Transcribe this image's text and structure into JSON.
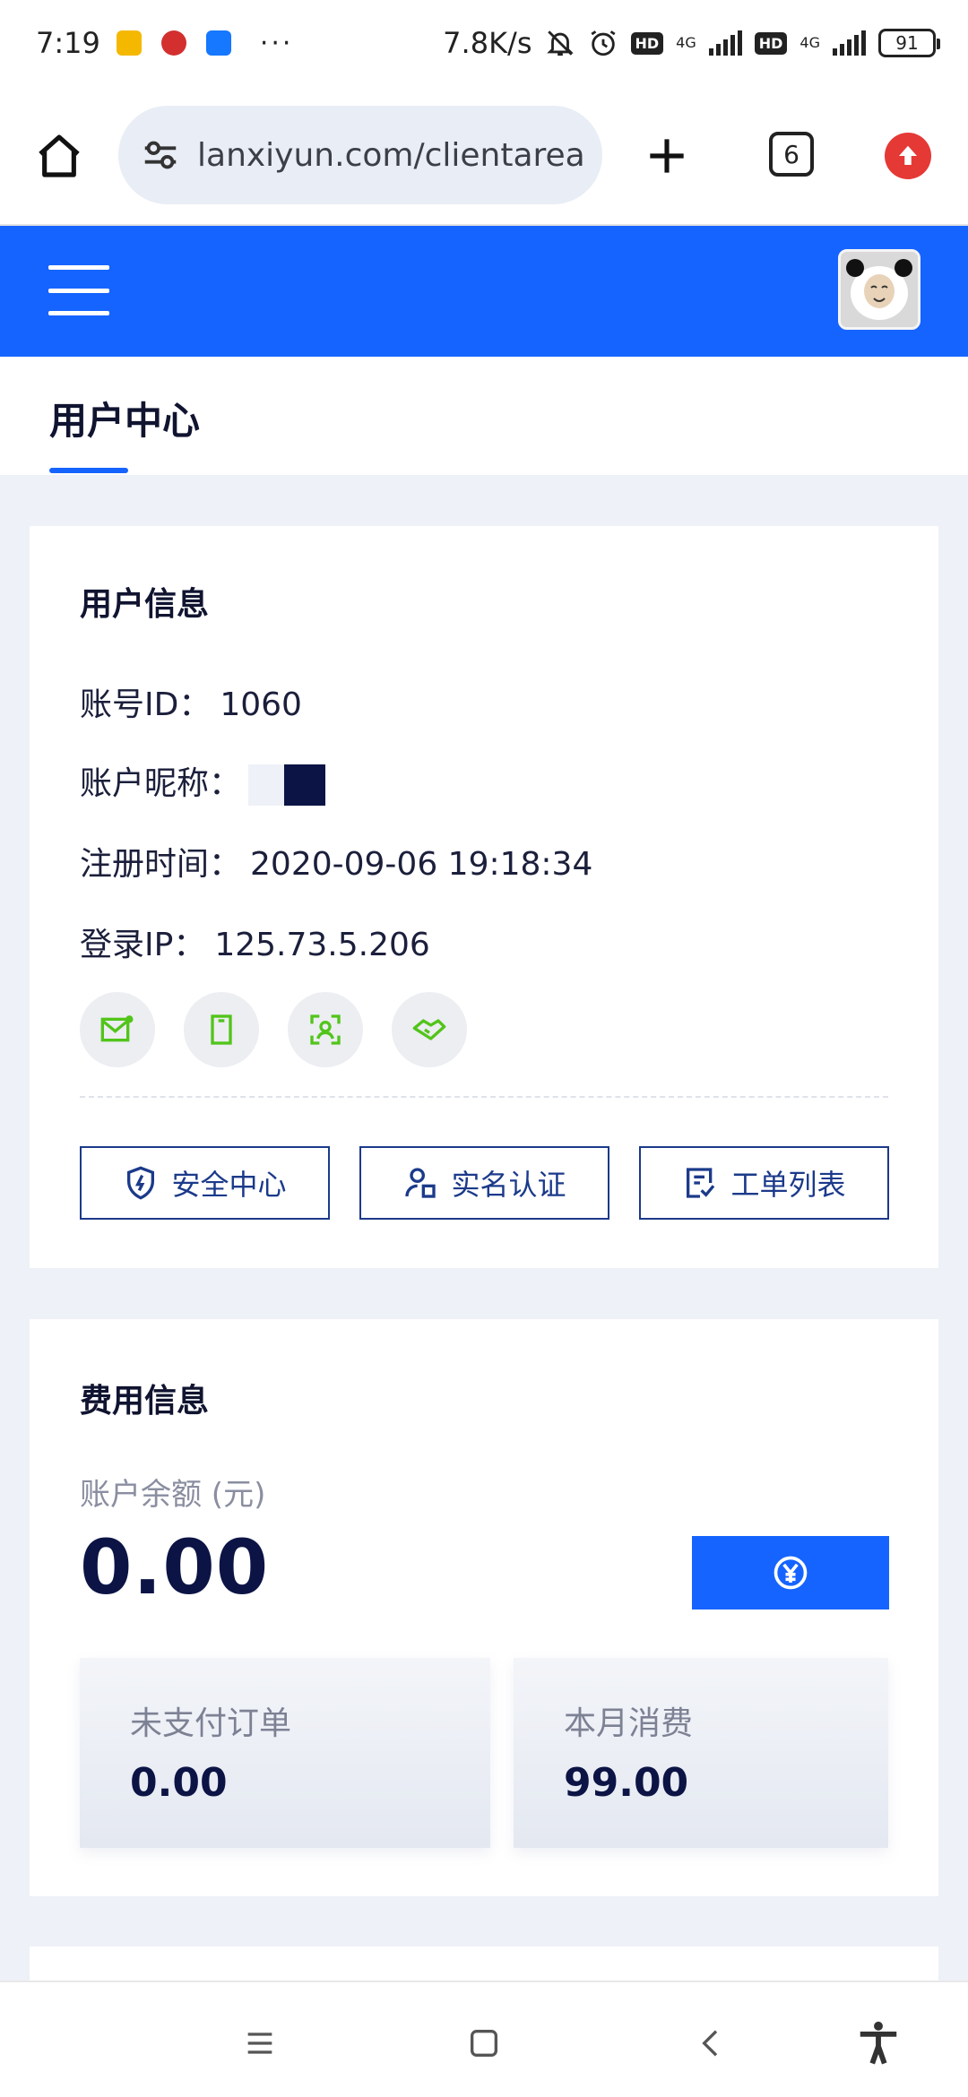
{
  "status_bar": {
    "time": "7:19",
    "more": "···",
    "net_speed": "7.8K/s",
    "net1": "4G",
    "net2": "4G",
    "hd1": "HD",
    "hd2": "HD",
    "battery": "91"
  },
  "browser": {
    "url": "lanxiyun.com/clientarea",
    "tab_count": "6"
  },
  "page": {
    "title": "用户中心"
  },
  "user_info": {
    "heading": "用户信息",
    "account_id_label": "账号ID：",
    "account_id": "1060",
    "nickname_label": "账户昵称：",
    "register_label": "注册时间：",
    "register_time": "2020-09-06 19:18:34",
    "login_ip_label": "登录IP：",
    "login_ip": "125.73.5.206",
    "verify_icons": [
      "email-verified-icon",
      "phone-verified-icon",
      "realname-verified-icon",
      "wechat-verified-icon"
    ],
    "buttons": {
      "security": "安全中心",
      "realname": "实名认证",
      "tickets": "工单列表"
    }
  },
  "fee_info": {
    "heading": "费用信息",
    "balance_label": "账户余额 (元)",
    "balance": "0.00",
    "unpaid_label": "未支付订单",
    "unpaid_value": "0.00",
    "month_label": "本月消费",
    "month_value": "99.00"
  },
  "colors": {
    "accent": "#1664ff",
    "verify_green": "#52c41a",
    "button_border": "#1b3a8a",
    "alert_red": "#e53935"
  }
}
